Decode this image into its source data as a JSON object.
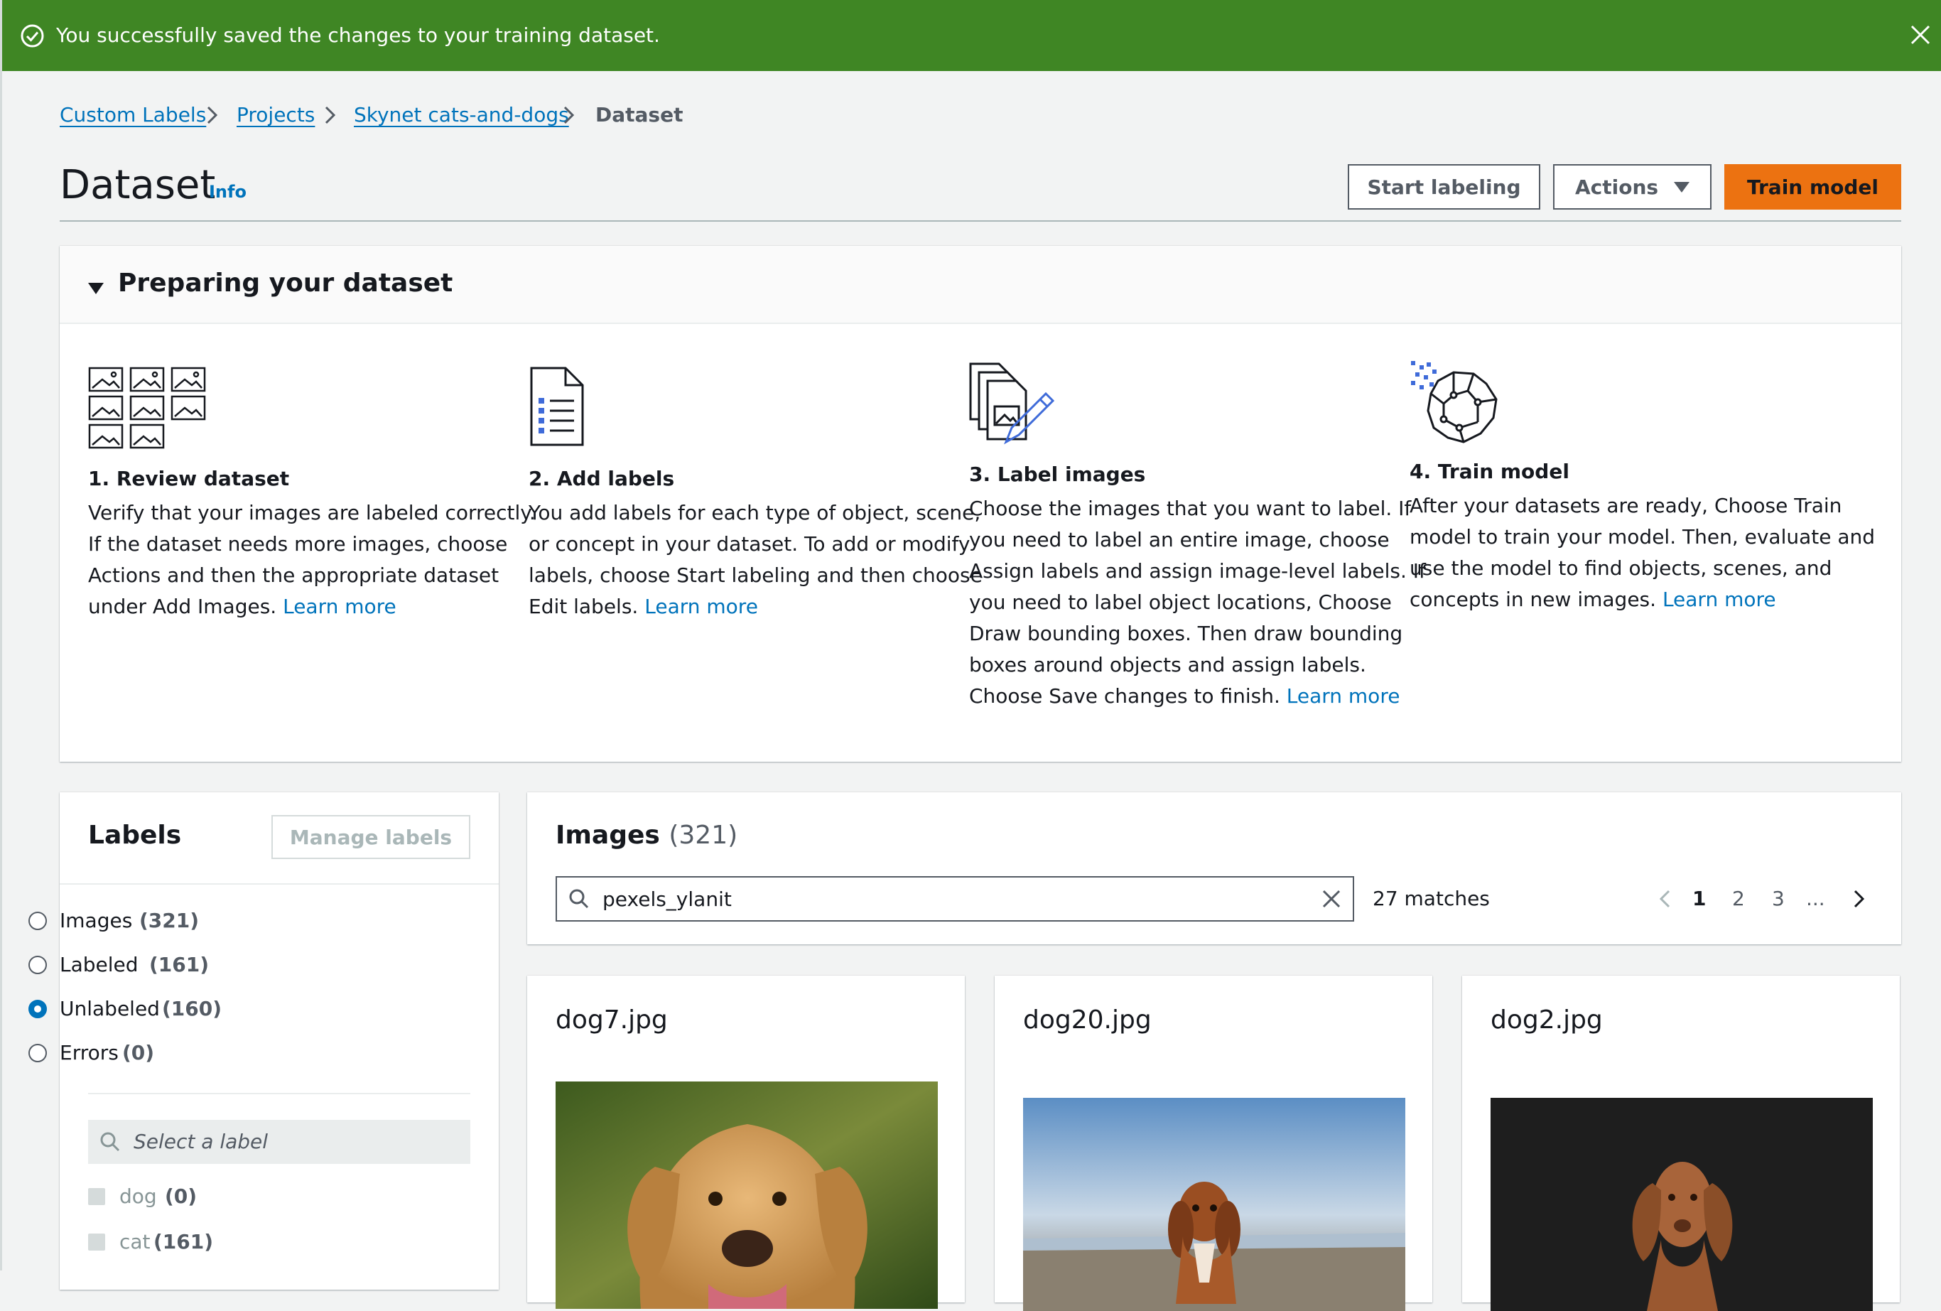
{
  "flash": {
    "message": "You successfully saved the changes to your training dataset.",
    "color": "#3f8624"
  },
  "breadcrumb": {
    "items": [
      "Custom Labels",
      "Projects",
      "Skynet cats-and-dogs",
      "Dataset"
    ]
  },
  "header": {
    "title": "Dataset",
    "info": "Info",
    "start_labeling": "Start labeling",
    "actions": "Actions",
    "train_model": "Train model",
    "accent_color": "#ec7211"
  },
  "preparing": {
    "title": "Preparing your dataset",
    "learn_more": "Learn more",
    "steps": [
      {
        "icon": "image-grid-icon",
        "title": "1. Review dataset",
        "lines": [
          "Verify that your images are labeled correctly.",
          "If the dataset needs more images, choose",
          "Actions and then the appropriate dataset",
          "under Add Images. "
        ]
      },
      {
        "icon": "checklist-document-icon",
        "title": "2. Add labels",
        "lines": [
          "You add labels for each type of object, scene,",
          "or concept in your dataset. To add or modify",
          "labels, choose Start labeling and then choose",
          "Edit labels. "
        ]
      },
      {
        "icon": "label-images-pencil-icon",
        "title": "3. Label images",
        "lines": [
          "Choose the images that you want to label. If",
          "you need to label an entire image, choose",
          "Assign labels and assign image-level labels. If",
          "you need to label object locations, Choose",
          "Draw bounding boxes. Then draw bounding",
          "boxes around objects and assign labels.",
          "Choose Save changes to finish. "
        ]
      },
      {
        "icon": "brain-circuit-icon",
        "title": "4. Train model",
        "lines": [
          "After your datasets are ready, Choose Train",
          "model to train your model. Then, evaluate and",
          "use the model to find objects, scenes, and",
          "concepts in new images. "
        ]
      }
    ]
  },
  "labels_panel": {
    "title": "Labels",
    "manage": "Manage labels",
    "filters": [
      {
        "label": "Images",
        "count": "(321)",
        "selected": false
      },
      {
        "label": "Labeled",
        "count": "(161)",
        "selected": false
      },
      {
        "label": "Unlabeled",
        "count": "(160)",
        "selected": true
      },
      {
        "label": "Errors",
        "count": "(0)",
        "selected": false
      }
    ],
    "search_placeholder": "Select a label",
    "labels": [
      {
        "label": "dog",
        "count": "(0)"
      },
      {
        "label": "cat",
        "count": "(161)"
      }
    ]
  },
  "images_panel": {
    "title": "Images",
    "count": "(321)",
    "search_value": "pexels_ylanit",
    "matches": "27 matches",
    "pages": [
      "1",
      "2",
      "3",
      "..."
    ],
    "current_page": "1",
    "cards": [
      {
        "name": "dog7.jpg"
      },
      {
        "name": "dog20.jpg"
      },
      {
        "name": "dog2.jpg"
      }
    ]
  }
}
